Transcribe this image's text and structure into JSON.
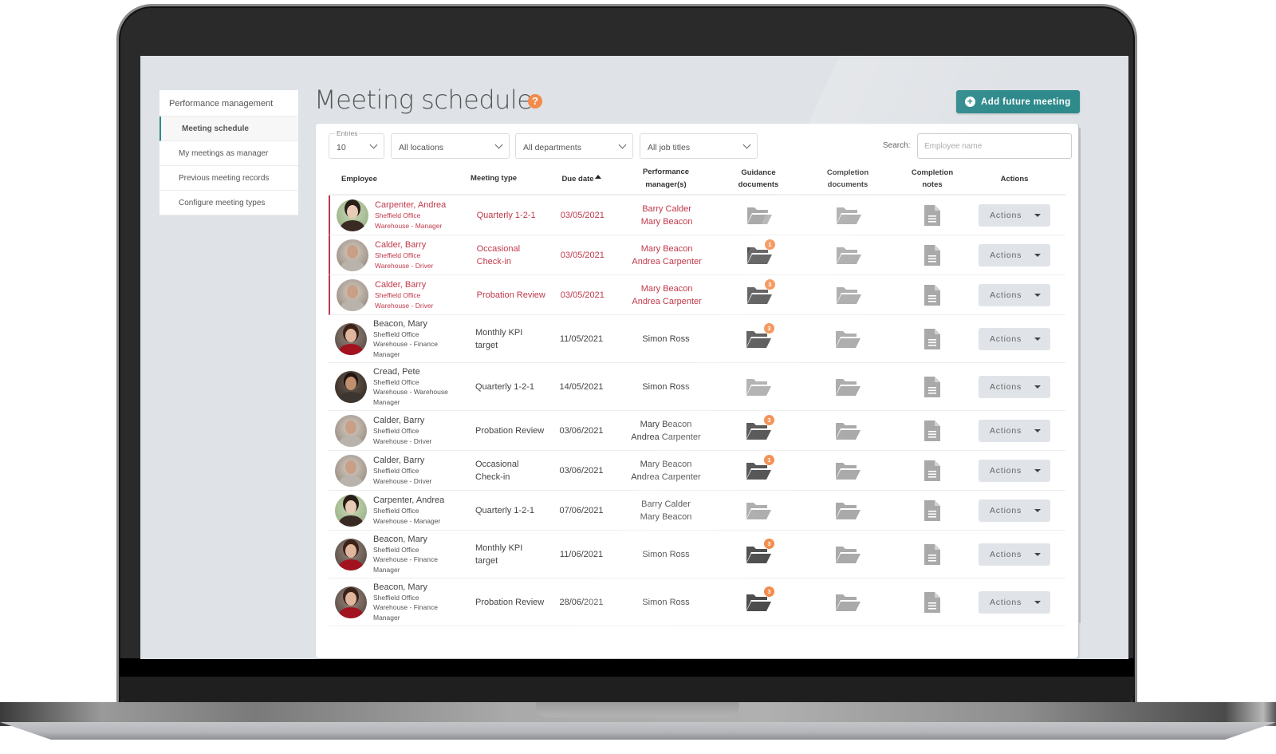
{
  "sidebar": {
    "header": "Performance management",
    "items": [
      {
        "label": "Meeting schedule",
        "active": true
      },
      {
        "label": "My meetings as manager",
        "active": false
      },
      {
        "label": "Previous meeting records",
        "active": false
      },
      {
        "label": "Configure meeting types",
        "active": false
      }
    ]
  },
  "header": {
    "title": "Meeting schedule",
    "help_icon": "?",
    "add_button_label": "Add future meeting",
    "add_button_icon": "plus-circle-icon"
  },
  "filters": {
    "entries_label": "Entries",
    "entries_value": "10",
    "location": "All locations",
    "department": "All departments",
    "job_title": "All job titles",
    "search_label": "Search:",
    "search_placeholder": "Employee name",
    "search_value": ""
  },
  "table": {
    "columns": {
      "employee": "Employee",
      "meeting_type": "Meeting type",
      "due_date": "Due date",
      "pm_line1": "Performance",
      "pm_line2": "manager(s)",
      "guid_line1": "Guidance",
      "guid_line2": "documents",
      "compd_line1": "Completion",
      "compd_line2": "documents",
      "notes_line1": "Completion",
      "notes_line2": "notes",
      "actions": "Actions"
    },
    "sort": {
      "column": "due_date",
      "direction": "ascending"
    },
    "action_label": "Actions",
    "colors": {
      "overdue": "#c0394b",
      "accent": "#2f8a8c",
      "badge": "#f28a4a"
    },
    "rows": [
      {
        "name": "Carpenter, Andrea",
        "office": "Sheffield Office",
        "role": "Warehouse - Manager",
        "avatar": "andrea",
        "type_l1": "Quarterly 1-2-1",
        "type_l2": "",
        "due": "03/05/2021",
        "pm1": "Barry Calder",
        "pm2": "Mary Beacon",
        "guidance_count": 0,
        "overdue": true
      },
      {
        "name": "Calder, Barry",
        "office": "Sheffield Office",
        "role": "Warehouse - Driver",
        "avatar": "barry",
        "type_l1": "Occasional",
        "type_l2": "Check-in",
        "due": "03/05/2021",
        "pm1": "Mary Beacon",
        "pm2": "Andrea Carpenter",
        "guidance_count": 1,
        "overdue": true
      },
      {
        "name": "Calder, Barry",
        "office": "Sheffield Office",
        "role": "Warehouse - Driver",
        "avatar": "barry",
        "type_l1": "Probation Review",
        "type_l2": "",
        "due": "03/05/2021",
        "pm1": "Mary Beacon",
        "pm2": "Andrea Carpenter",
        "guidance_count": 3,
        "overdue": true
      },
      {
        "name": "Beacon, Mary",
        "office": "Sheffield Office",
        "role": "Warehouse - Finance",
        "role2": "Manager",
        "avatar": "mary",
        "type_l1": "Monthly KPI",
        "type_l2": "target",
        "due": "11/05/2021",
        "pm1": "Simon Ross",
        "pm2": "",
        "guidance_count": 3,
        "overdue": false
      },
      {
        "name": "Cread, Pete",
        "office": "Sheffield Office",
        "role": "Warehouse - Warehouse",
        "role2": "Manager",
        "avatar": "pete",
        "type_l1": "Quarterly 1-2-1",
        "type_l2": "",
        "due": "14/05/2021",
        "pm1": "Simon Ross",
        "pm2": "",
        "guidance_count": 0,
        "overdue": false
      },
      {
        "name": "Calder, Barry",
        "office": "Sheffield Office",
        "role": "Warehouse - Driver",
        "avatar": "barry",
        "type_l1": "Probation Review",
        "type_l2": "",
        "due": "03/06/2021",
        "pm1": "Mary Beacon",
        "pm2": "Andrea Carpenter",
        "guidance_count": 3,
        "overdue": false
      },
      {
        "name": "Calder, Barry",
        "office": "Sheffield Office",
        "role": "Warehouse - Driver",
        "avatar": "barry",
        "type_l1": "Occasional",
        "type_l2": "Check-in",
        "due": "03/06/2021",
        "pm1": "Mary Beacon",
        "pm2": "Andrea Carpenter",
        "guidance_count": 1,
        "overdue": false
      },
      {
        "name": "Carpenter, Andrea",
        "office": "Sheffield Office",
        "role": "Warehouse - Manager",
        "avatar": "andrea",
        "type_l1": "Quarterly 1-2-1",
        "type_l2": "",
        "due": "07/06/2021",
        "pm1": "Barry Calder",
        "pm2": "Mary Beacon",
        "guidance_count": 0,
        "overdue": false
      },
      {
        "name": "Beacon, Mary",
        "office": "Sheffield Office",
        "role": "Warehouse - Finance",
        "role2": "Manager",
        "avatar": "mary",
        "type_l1": "Monthly KPI",
        "type_l2": "target",
        "due": "11/06/2021",
        "pm1": "Simon Ross",
        "pm2": "",
        "guidance_count": 3,
        "overdue": false
      },
      {
        "name": "Beacon, Mary",
        "office": "Sheffield Office",
        "role": "Warehouse - Finance",
        "role2": "Manager",
        "avatar": "mary",
        "type_l1": "Probation Review",
        "type_l2": "",
        "due": "28/06/2021",
        "pm1": "Simon Ross",
        "pm2": "",
        "guidance_count": 3,
        "overdue": false
      }
    ]
  }
}
